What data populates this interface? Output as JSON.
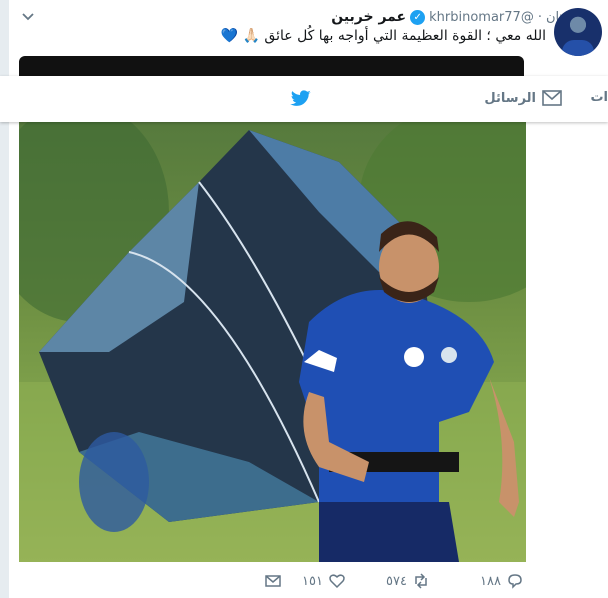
{
  "tweet": {
    "display_name": "عمر خربين",
    "handle": "@khrbinomar77",
    "separator": "·",
    "time": "ساعتان",
    "text": "الله معي ؛ القوة العظيمة التي أواجه بها كُل عائق",
    "emoji_pray": "🙏🏻",
    "emoji_heart": "💙",
    "photo_caption": "",
    "actions": {
      "reply_count": "١٨٨",
      "retweet_count": "٥٧٤",
      "like_count": "١٥١"
    }
  },
  "nav": {
    "messages_label": "الرسائل",
    "notifications_label": "ات"
  },
  "colors": {
    "brand": "#1da1f2",
    "muted": "#657786",
    "jersey": "#1f4fb4"
  },
  "icons": [
    "caret-down-icon",
    "verified-icon",
    "envelope-icon",
    "twitter-bird-icon",
    "reply-icon",
    "retweet-icon",
    "heart-icon",
    "dm-icon"
  ]
}
